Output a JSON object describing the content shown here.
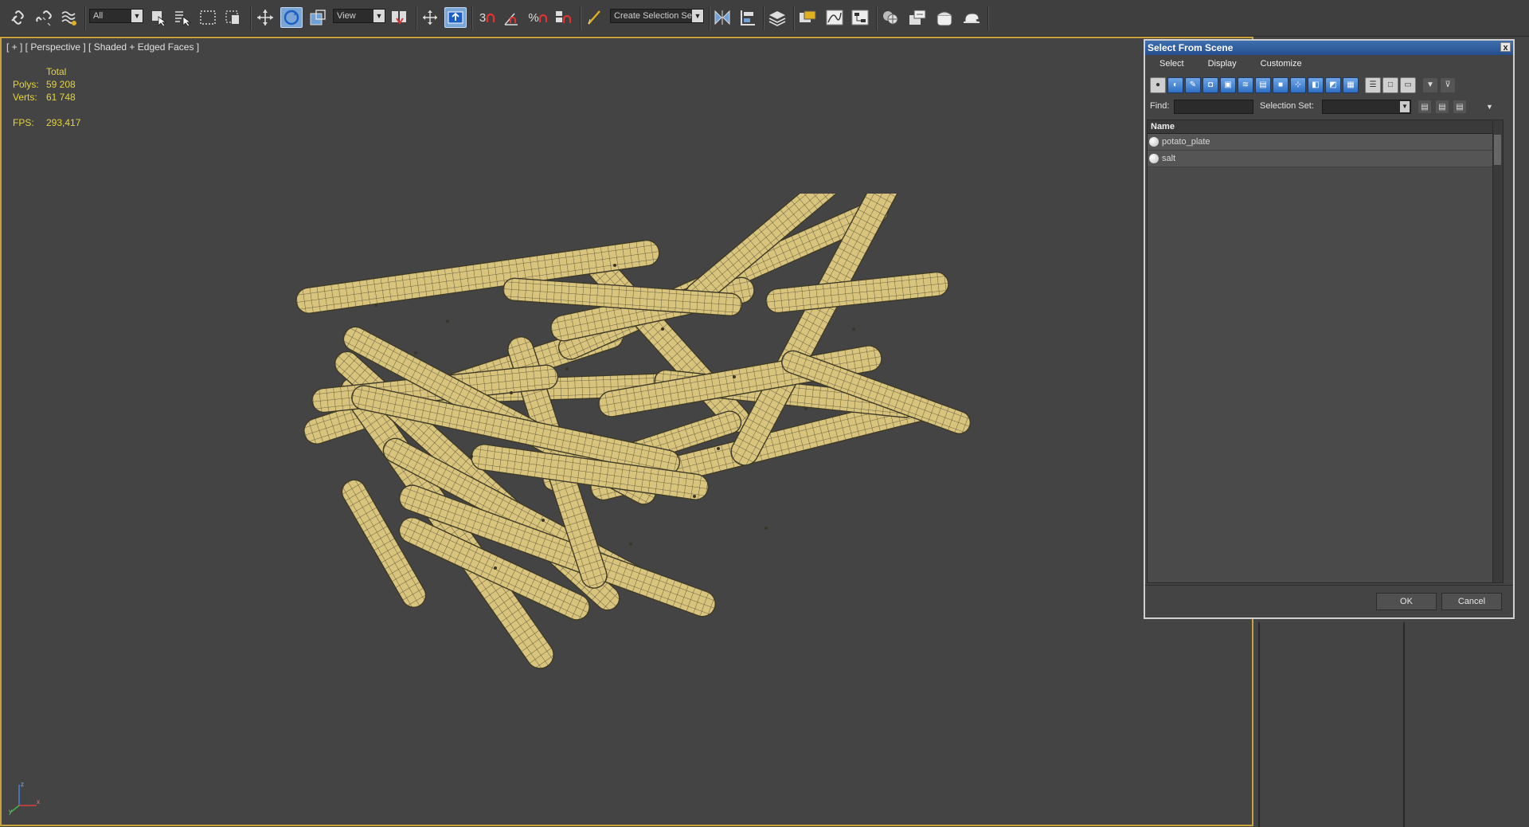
{
  "toolbar": {
    "filter_value": "All",
    "refcoord_value": "View",
    "selection_set_value": "Create Selection Se",
    "snap_label": "3",
    "percent_label": "%"
  },
  "viewport": {
    "label": "[ + ] [ Perspective ] [ Shaded + Edged Faces ]",
    "stats": {
      "header": "Total",
      "polys_label": "Polys:",
      "polys_value": "59 208",
      "verts_label": "Verts:",
      "verts_value": "61 748",
      "fps_label": "FPS:",
      "fps_value": "293,417"
    },
    "axis": {
      "x": "x",
      "y": "y",
      "z": "z"
    }
  },
  "dialog": {
    "title": "Select From Scene",
    "close_label": "x",
    "menu": [
      "Select",
      "Display",
      "Customize"
    ],
    "find_label": "Find:",
    "find_value": "",
    "selection_set_label": "Selection Set:",
    "selection_set_value": "",
    "column_name": "Name",
    "column_sort": "/",
    "rows": [
      {
        "name": "potato_plate"
      },
      {
        "name": "salt"
      }
    ],
    "ok_label": "OK",
    "cancel_label": "Cancel"
  },
  "colors": {
    "viewport_bg": "#444444",
    "mesh_fill": "#d8c47c",
    "mesh_line": "#4a4430",
    "stats_text": "#e6d43a",
    "viewport_border": "#c8a23c",
    "title_bar": "#2f5c9c"
  }
}
